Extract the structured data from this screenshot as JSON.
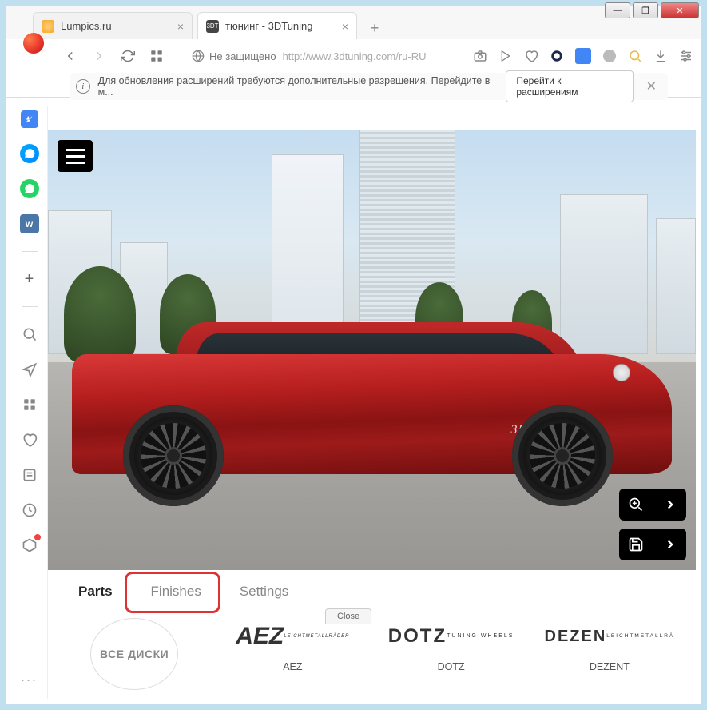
{
  "window": {
    "min": "—",
    "max": "❐",
    "close": "✕"
  },
  "tabs": [
    {
      "title": "Lumpics.ru",
      "active": false
    },
    {
      "title": "тюнинг - 3DTuning",
      "active": true,
      "icon_text": "3DT"
    }
  ],
  "tab_plus": "+",
  "nav": {
    "security_label": "Не защищено",
    "url": "http://www.3dtuning.com/ru-RU"
  },
  "ext_bar": {
    "message": "Для обновления расширений требуются дополнительные разрешения. Перейдите в м...",
    "button": "Перейти к расширениям",
    "close": "✕"
  },
  "sidebar": {
    "plus": "+",
    "vk_label": "w",
    "more": "..."
  },
  "car": {
    "badge": "3DT"
  },
  "config_tabs": [
    {
      "label": "Parts",
      "active": true
    },
    {
      "label": "Finishes",
      "active": false,
      "highlighted": true
    },
    {
      "label": "Settings",
      "active": false
    }
  ],
  "close_btn": "Close",
  "brands": {
    "all_label": "ВСЕ ДИСКИ",
    "items": [
      {
        "logo_main": "AEZ",
        "logo_sub": "LEICHTMETALLRÄDER",
        "name": "AEZ"
      },
      {
        "logo_main": "DOTZ",
        "logo_sub": "TUNING WHEELS",
        "name": "DOTZ"
      },
      {
        "logo_main": "DEZEN",
        "logo_sub": "LEICHTMETALLRÄ",
        "name": "DEZENT"
      }
    ]
  }
}
